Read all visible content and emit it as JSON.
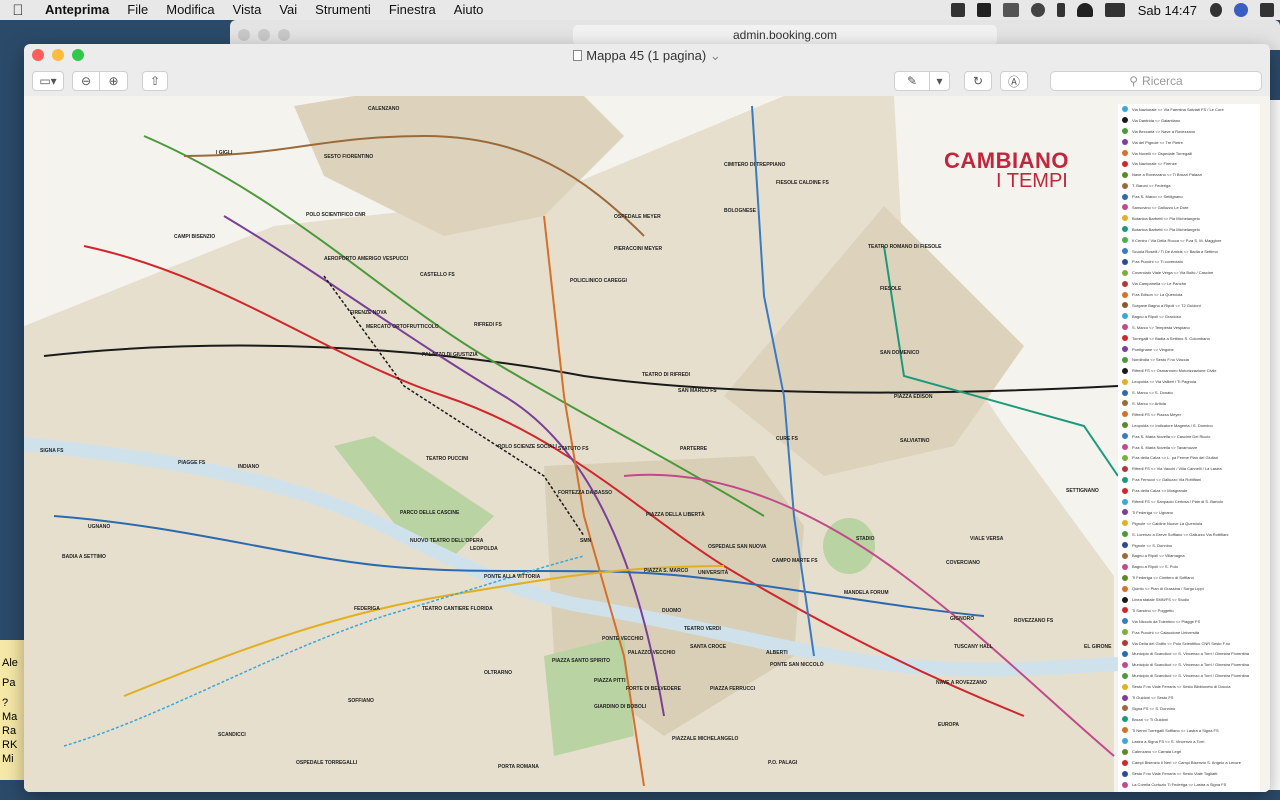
{
  "menubar": {
    "app": "Anteprima",
    "items": [
      "File",
      "Modifica",
      "Vista",
      "Vai",
      "Strumenti",
      "Finestra",
      "Aiuto"
    ],
    "clock": "Sab 14:47"
  },
  "browser_behind": {
    "url": "admin.booking.com"
  },
  "window": {
    "title": "Mappa 45 (1 pagina)",
    "search_placeholder": "Ricerca"
  },
  "desktop_note": {
    "lines": [
      "Ale",
      "Pa",
      "?",
      "Ma",
      "Ra",
      "RK",
      "Mi"
    ]
  },
  "map": {
    "brand_line1": "CAMBIANO",
    "brand_line2": "I TEMPI",
    "labels": [
      "CALENZANO",
      "SESTO FIORENTINO",
      "I GIGLI",
      "POLO SCIENTIFICO CNR",
      "CAMPI BISENZIO",
      "AEROPORTO AMERIGO VESPUCCI",
      "CASTELLO FS",
      "OSPEDALE MEYER",
      "PIERACCINI MEYER",
      "POLICLINICO CAREGGI",
      "CIMITERO DI TREPPIANO",
      "FIESOLE CALDINE FS",
      "BOLOGNESE",
      "TEATRO ROMANO DI FIESOLE",
      "FIESOLE",
      "SAN DOMENICO",
      "FIRENZE NOVA",
      "MERCATO ORTOFRUTTICOLO",
      "PALAZZO DI GIUSTIZIA",
      "RIFREDI FS",
      "TEATRO DI RIFREDI",
      "SAN MARCO FS",
      "PIAZZA EDISON",
      "SALVIATINO",
      "SIGNA FS",
      "PIAGGE FS",
      "INDIANO",
      "TEATRO PUCCINI",
      "POLO SCIENZE SOCIALI",
      "STATUTO FS",
      "PARTERRE",
      "CURE FS",
      "FORTEZZA DA BASSO",
      "PARCO DELLE CASCINE",
      "NUOVO TEATRO DELL'OPERA",
      "LEOPOLDA",
      "SMN",
      "PIAZZA DELLA LIBERTÀ",
      "OSPEDALE SAN NUOVA",
      "CAMPO MARTE FS",
      "STADIO",
      "VIALE VERSA",
      "SETTIGNANO",
      "COVERCIANO",
      "UGNANO",
      "BADIA A SETTIMO",
      "PONTE ALLA VITTORIA",
      "TEATRO CANTIERE FLORIDA",
      "FEDERIGA",
      "PIAZZA S. MARCO",
      "UNIVERSITÀ",
      "DUOMO",
      "TEATRO VERDI",
      "SANTA CROCE",
      "PONTE VECCHIO",
      "PALAZZO VECCHIO",
      "PIAZZA SANTO SPIRITO",
      "ALBERTI",
      "PONTE SAN NICCOLÒ",
      "MANDELA FORUM",
      "GIGNORO",
      "ROVEZZANO FS",
      "TUSCANY HALL",
      "EL GIRONE",
      "OLTRARNO",
      "PIAZZA PITTI",
      "FORTE DI BELVEDERE",
      "GIARDINO DI BOBOLI",
      "PIAZZA FERRUCCI",
      "NAVE A ROVEZZANO",
      "EUROPA",
      "SOFFIANO",
      "SCANDICCI",
      "OSPEDALE TORREGALLI",
      "PIAZZALE MICHELANGELO",
      "P.O. PALAGI",
      "PORTA ROMANA"
    ],
    "legend": [
      {
        "code": "1",
        "color": "#3aa7d9",
        "text": "Via Nazionale <> Via Faentina Salviati FS / Le Cure"
      },
      {
        "code": "2",
        "color": "#1a1a1a",
        "text": "Via Dantrida <> Galantiano"
      },
      {
        "code": "3",
        "color": "#4a9a3a",
        "text": "Via Beccaria <> Nave a Rovezzano"
      },
      {
        "code": "4",
        "color": "#7a3f9a",
        "text": "Via del Pignole <> Tre Pietre"
      },
      {
        "code": "5",
        "color": "#d4702a",
        "text": "Via Novelli <> Ospedale Torregalli"
      },
      {
        "code": "6",
        "color": "#d1262b",
        "text": "Via Nazionale <> Firenze"
      },
      {
        "code": "7",
        "color": "#5a8a2a",
        "text": "Nave a Rovezzano <> Ti Bruzzi Palazzi"
      },
      {
        "code": "8",
        "color": "#9a6a3a",
        "text": "T. Baroni <> Federiga"
      },
      {
        "code": "9",
        "color": "#2a6ab0",
        "text": "P.za S. Marco <> Settignano"
      },
      {
        "code": "10",
        "color": "#c24a8a",
        "text": "Sansovino <> Galluzzo Le Dore"
      },
      {
        "code": "11",
        "color": "#e0b020",
        "text": "Botanica Barbetti <> Pia Michelangelo"
      },
      {
        "code": "12",
        "color": "#1a9a7a",
        "text": "Botanica Barbetti <> Pia Michelangelo"
      },
      {
        "code": "13",
        "color": "#4ab04a",
        "text": "Il Centro / Via Della Rocca <> P.za S. M. Maggiore"
      },
      {
        "code": "14",
        "color": "#3a7ac0",
        "text": "Scuola Roselli / Ti De Amicis <> Badia a Settimo"
      },
      {
        "code": "17",
        "color": "#2a4a9a",
        "text": "P.za Puccini <> Ti coverciato"
      },
      {
        "code": "18",
        "color": "#7ab03a",
        "text": "Coverciato Viale Verga <> Via Boito / Cascine"
      },
      {
        "code": "20",
        "color": "#b03a3a",
        "text": "Via Campanella <> Le Panche"
      },
      {
        "code": "22",
        "color": "#d4702a",
        "text": "P.za Edison <> La Querciola"
      },
      {
        "code": "23",
        "color": "#8a5a2a",
        "text": "Sorgane Bagno a Ripoli <> T2 Guidoni"
      },
      {
        "code": "25",
        "color": "#3aa7d9",
        "text": "Bagno a Ripoli <> Gracioso"
      },
      {
        "code": "26",
        "color": "#c24a8a",
        "text": "S. Marco <> Tempesta Vespiano"
      },
      {
        "code": "27",
        "color": "#d1262b",
        "text": "Torregalli <> Badia a Settimo S. Colombano"
      },
      {
        "code": "28",
        "color": "#7a3f9a",
        "text": "Pontignane <> Vingone"
      },
      {
        "code": "29",
        "color": "#4a9a3a",
        "text": "Nordindia <> Sesto F.no Viaccia"
      },
      {
        "code": "30",
        "color": "#1a1a1a",
        "text": "Rifredi FS <> Osmannoro Motorizzazione Civile"
      },
      {
        "code": "31",
        "color": "#e0b020",
        "text": "Leopolda <> Via Vallieri / Ti Pagnola"
      },
      {
        "code": "32",
        "color": "#2a6ab0",
        "text": "S. Marco <> S. Donato"
      },
      {
        "code": "33",
        "color": "#9a6a3a",
        "text": "S. Marco <> Artiola"
      },
      {
        "code": "34",
        "color": "#d4702a",
        "text": "Rifredi FS <> Piazza Meyer"
      },
      {
        "code": "35",
        "color": "#5a8a2a",
        "text": "Leopolda <> Indicatore Magenta / S. Donnino"
      },
      {
        "code": "36",
        "color": "#3a7ac0",
        "text": "P.za S. Maria Novella <> Cascine Del Riccio"
      },
      {
        "code": "37",
        "color": "#c24a8a",
        "text": "P.za S. Maria Novella <> Tavarnuzze"
      },
      {
        "code": "38",
        "color": "#7ab03a",
        "text": "P.za della Calza <> L. pa Ferme Pian dei Giullari"
      },
      {
        "code": "40",
        "color": "#b03a3a",
        "text": "Rifredi FS <> Via Vacchi / Villa Cannelli / La Lastra"
      },
      {
        "code": "41",
        "color": "#1a9a7a",
        "text": "P.za Ferrucci <> Galluzzo Via Rottifiani"
      },
      {
        "code": "42",
        "color": "#d1262b",
        "text": "P.za della Calza <> Mosgrande"
      },
      {
        "code": "43",
        "color": "#3aa7d9",
        "text": "Rifredi FS <> Sanpaolo Certosa / Pian di S. Bartolo"
      },
      {
        "code": "44",
        "color": "#7a3f9a",
        "text": "Ti Federiga <> Ugnano"
      },
      {
        "code": "45",
        "color": "#e0b020",
        "text": "Pignole <> Caldine Nuove La Querciola"
      },
      {
        "code": "46",
        "color": "#4a9a3a",
        "text": "S. Lorenzo a Greve Soffiano <> Galluzzo Via Rottifiani"
      },
      {
        "code": "47",
        "color": "#2a4a9a",
        "text": "Pignole <> S. Donnino"
      },
      {
        "code": "48",
        "color": "#9a6a3a",
        "text": "Bagno a Ripoli <> Villamagna"
      },
      {
        "code": "49",
        "color": "#c24a8a",
        "text": "Bagno a Ripoli <> S. Polo"
      },
      {
        "code": "50",
        "color": "#5a8a2a",
        "text": "Ti Federiga <> Cimitero di Soffiano"
      },
      {
        "code": "51",
        "color": "#d4702a",
        "text": "Quinto <> Pian di Grassina / Sorgo Lippi"
      },
      {
        "code": "52",
        "color": "#1a1a1a",
        "text": "Linea statale SMN/FS <> Studio"
      },
      {
        "code": "54",
        "color": "#d1262b",
        "text": "Ti Sancino <> Poggetto"
      },
      {
        "code": "55",
        "color": "#3a7ac0",
        "text": "Via Niccolò da Tolentino <> Piagge FS"
      },
      {
        "code": "56",
        "color": "#7ab03a",
        "text": "P.za Puccini <> Caiaccione Università"
      },
      {
        "code": "57",
        "color": "#b03a3a",
        "text": "Via Della del Gottin <> Polo Scientifico CNR Sesto F.no"
      },
      {
        "code": "58",
        "color": "#2a6ab0",
        "text": "Municipio di Scandicci <> S. Vincenzo a Torri / Ginestra Fiorentina"
      },
      {
        "code": "59",
        "color": "#c24a8a",
        "text": "Municipio di Scandicci <> S. Vincenzo a Torri / Ginestra Fiorentina"
      },
      {
        "code": "60",
        "color": "#4a9a3a",
        "text": "Municipio di Scandicci <> S. Vincenzo a Torri / Ginestra Fiorentina"
      },
      {
        "code": "61",
        "color": "#e0b020",
        "text": "Sesto F.no Viale Ferraris <> Sesto Bibbioneto di Doccia"
      },
      {
        "code": "62",
        "color": "#7a3f9a",
        "text": "Ti Guidoni <> Sesto FS"
      },
      {
        "code": "63",
        "color": "#9a6a3a",
        "text": "Signa FS <> S. Donnino"
      },
      {
        "code": "64",
        "color": "#1a9a7a",
        "text": "Brozzi <> Ti Guidoni"
      },
      {
        "code": "65",
        "color": "#d4702a",
        "text": "Ti Nenni Torregalli Soffiano <> Lastra a Signa FS"
      },
      {
        "code": "66",
        "color": "#3aa7d9",
        "text": "Lastra a Signa FS <> S. Vincenzo a Torri"
      },
      {
        "code": "67",
        "color": "#5a8a2a",
        "text": "Calenzano <> Carraia Legri"
      },
      {
        "code": "68",
        "color": "#d1262b",
        "text": "Campi Bisenzio Il Neri <> Campi Bisenzio S. Angelo a Lecore"
      },
      {
        "code": "69",
        "color": "#2a4a9a",
        "text": "Sesto F.no Viale Ferraris <> Sesto Viale Togliatti"
      },
      {
        "code": "70",
        "color": "#c24a8a",
        "text": "La Corella Curtuzio Ti Federiga <> Lastra a Signa FS"
      }
    ]
  }
}
